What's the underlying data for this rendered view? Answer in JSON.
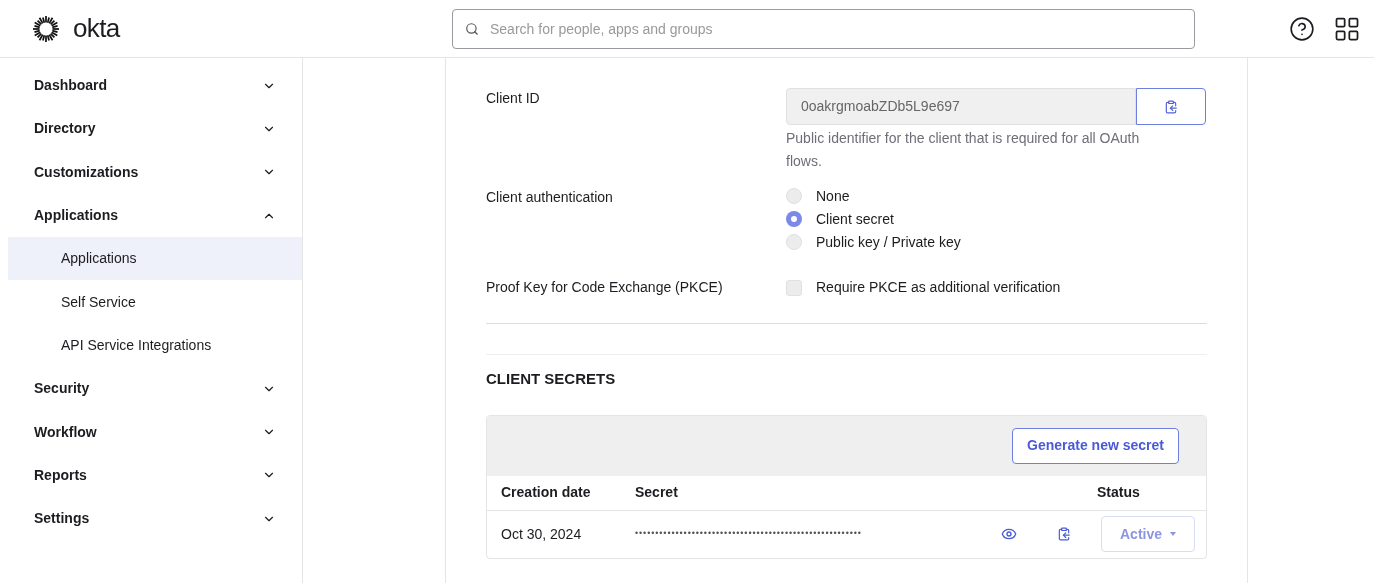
{
  "header": {
    "logo": "okta",
    "search": {
      "placeholder": "Search for people, apps and groups"
    }
  },
  "sidebar": {
    "items": [
      {
        "label": "Dashboard",
        "expanded": false
      },
      {
        "label": "Directory",
        "expanded": false
      },
      {
        "label": "Customizations",
        "expanded": false
      },
      {
        "label": "Applications",
        "expanded": true,
        "children": [
          {
            "label": "Applications",
            "selected": true
          },
          {
            "label": "Self Service",
            "selected": false
          },
          {
            "label": "API Service Integrations",
            "selected": false
          }
        ]
      },
      {
        "label": "Security",
        "expanded": false
      },
      {
        "label": "Workflow",
        "expanded": false
      },
      {
        "label": "Reports",
        "expanded": false
      },
      {
        "label": "Settings",
        "expanded": false
      }
    ]
  },
  "client_id": {
    "label": "Client ID",
    "value": "0oakrgmoabZDb5L9e697",
    "help": "Public identifier for the client that is required for all OAuth flows."
  },
  "client_authentication": {
    "label": "Client authentication",
    "options": [
      {
        "label": "None",
        "selected": false
      },
      {
        "label": "Client secret",
        "selected": true
      },
      {
        "label": "Public key / Private key",
        "selected": false
      }
    ]
  },
  "pkce": {
    "label": "Proof Key for Code Exchange (PKCE)",
    "option": "Require PKCE as additional verification",
    "checked": false
  },
  "client_secrets": {
    "title": "CLIENT SECRETS",
    "generate_button": "Generate new secret",
    "columns": [
      "Creation date",
      "Secret",
      "Status"
    ],
    "rows": [
      {
        "creation_date": "Oct 30, 2024",
        "secret": "••••••••••••••••••••••••••••••••••••••••••••••••••••••••",
        "status": "Active",
        "disabled": true
      }
    ]
  }
}
